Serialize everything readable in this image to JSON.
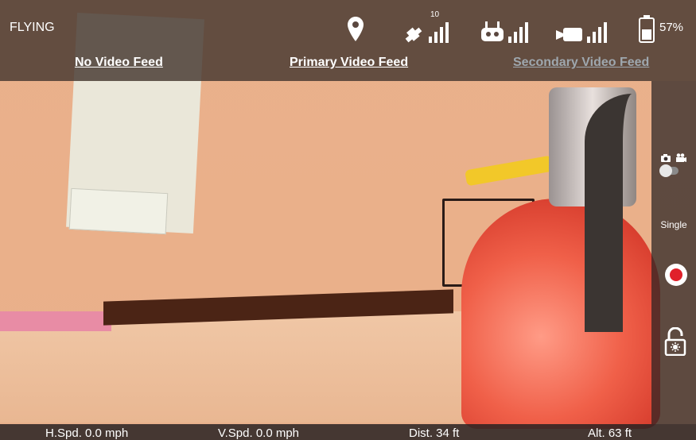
{
  "status": {
    "flight_mode": "FLYING",
    "satellite_count": "10",
    "battery_percent": "57%",
    "icons": [
      "location-pin-icon",
      "satellite-icon",
      "remote-controller-icon",
      "video-camera-icon",
      "battery-icon"
    ]
  },
  "feeds": {
    "no_video": "No Video Feed",
    "primary": "Primary Video Feed",
    "secondary": "Secondary Video Feed"
  },
  "side_panel": {
    "shoot_mode": "Single",
    "icons": [
      "photo-camera-icon",
      "video-camera-icon",
      "record-icon",
      "lock-open-icon"
    ]
  },
  "telemetry": {
    "h_speed": "H.Spd. 0.0 mph",
    "v_speed": "V.Spd. 0.0 mph",
    "distance": "Dist. 34 ft",
    "altitude": "Alt. 63 ft"
  },
  "colors": {
    "record": "#e0202a",
    "disabled_tab": "#9ea7ae"
  }
}
